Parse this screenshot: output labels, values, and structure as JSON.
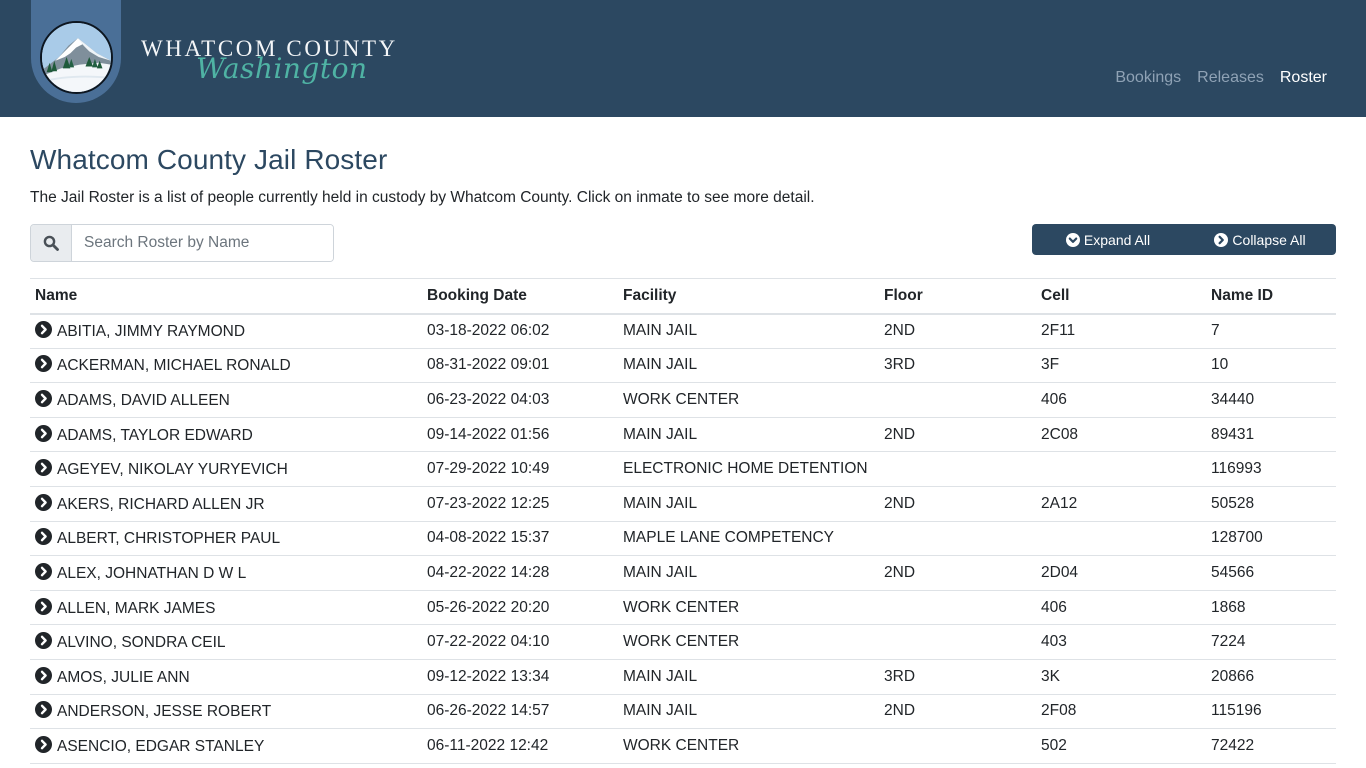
{
  "header": {
    "brand_title": "WHATCOM COUNTY",
    "brand_script": "Washington",
    "logo_icon": "mountain-landscape-logo",
    "nav": [
      {
        "label": "Bookings",
        "active": false
      },
      {
        "label": "Releases",
        "active": false
      },
      {
        "label": "Roster",
        "active": true
      }
    ]
  },
  "page": {
    "title": "Whatcom County Jail Roster",
    "description": "The Jail Roster is a list of people currently held in custody by Whatcom County. Click on inmate to see more detail."
  },
  "search": {
    "icon": "search-icon",
    "placeholder": "Search Roster by Name",
    "value": ""
  },
  "actions": {
    "expand_all": "Expand All",
    "collapse_all": "Collapse All",
    "expand_icon": "chevron-circle-down-icon",
    "collapse_icon": "chevron-circle-right-icon"
  },
  "colors": {
    "primary": "#2c4861",
    "logo_tab": "#4a6f97",
    "script_accent": "#4fb3a4",
    "nav_inactive": "#8fa2b5"
  },
  "table": {
    "columns": [
      "Name",
      "Booking Date",
      "Facility",
      "Floor",
      "Cell",
      "Name ID"
    ],
    "rows": [
      {
        "name": "ABITIA, JIMMY RAYMOND",
        "booking_date": "03-18-2022 06:02",
        "facility": "MAIN JAIL",
        "floor": "2ND",
        "cell": "2F11",
        "name_id": "7"
      },
      {
        "name": "ACKERMAN, MICHAEL RONALD",
        "booking_date": "08-31-2022 09:01",
        "facility": "MAIN JAIL",
        "floor": "3RD",
        "cell": "3F",
        "name_id": "10"
      },
      {
        "name": "ADAMS, DAVID ALLEEN",
        "booking_date": "06-23-2022 04:03",
        "facility": "WORK CENTER",
        "floor": "",
        "cell": "406",
        "name_id": "34440"
      },
      {
        "name": "ADAMS, TAYLOR EDWARD",
        "booking_date": "09-14-2022 01:56",
        "facility": "MAIN JAIL",
        "floor": "2ND",
        "cell": "2C08",
        "name_id": "89431"
      },
      {
        "name": "AGEYEV, NIKOLAY YURYEVICH",
        "booking_date": "07-29-2022 10:49",
        "facility": "ELECTRONIC HOME DETENTION",
        "floor": "",
        "cell": "",
        "name_id": "116993"
      },
      {
        "name": "AKERS, RICHARD ALLEN JR",
        "booking_date": "07-23-2022 12:25",
        "facility": "MAIN JAIL",
        "floor": "2ND",
        "cell": "2A12",
        "name_id": "50528"
      },
      {
        "name": "ALBERT, CHRISTOPHER PAUL",
        "booking_date": "04-08-2022 15:37",
        "facility": "MAPLE LANE COMPETENCY",
        "floor": "",
        "cell": "",
        "name_id": "128700"
      },
      {
        "name": "ALEX, JOHNATHAN D W L",
        "booking_date": "04-22-2022 14:28",
        "facility": "MAIN JAIL",
        "floor": "2ND",
        "cell": "2D04",
        "name_id": "54566"
      },
      {
        "name": "ALLEN, MARK JAMES",
        "booking_date": "05-26-2022 20:20",
        "facility": "WORK CENTER",
        "floor": "",
        "cell": "406",
        "name_id": "1868"
      },
      {
        "name": "ALVINO, SONDRA CEIL",
        "booking_date": "07-22-2022 04:10",
        "facility": "WORK CENTER",
        "floor": "",
        "cell": "403",
        "name_id": "7224"
      },
      {
        "name": "AMOS, JULIE ANN",
        "booking_date": "09-12-2022 13:34",
        "facility": "MAIN JAIL",
        "floor": "3RD",
        "cell": "3K",
        "name_id": "20866"
      },
      {
        "name": "ANDERSON, JESSE ROBERT",
        "booking_date": "06-26-2022 14:57",
        "facility": "MAIN JAIL",
        "floor": "2ND",
        "cell": "2F08",
        "name_id": "115196"
      },
      {
        "name": "ASENCIO, EDGAR STANLEY",
        "booking_date": "06-11-2022 12:42",
        "facility": "WORK CENTER",
        "floor": "",
        "cell": "502",
        "name_id": "72422"
      }
    ]
  }
}
